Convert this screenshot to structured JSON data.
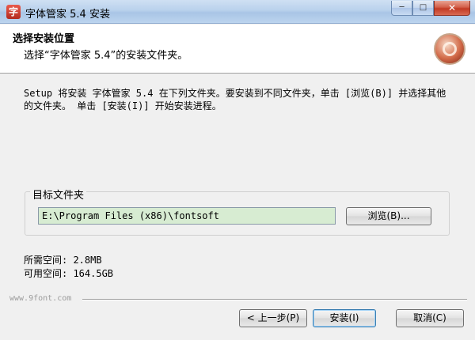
{
  "window": {
    "title": "字体管家 5.4 安装",
    "app_icon": "font-manager-icon",
    "minimize_glyph": "─",
    "maximize_glyph": "□",
    "close_glyph": "✕"
  },
  "header": {
    "title": "选择安装位置",
    "subtitle": "选择“字体管家 5.4”的安装文件夹。",
    "logo_icon": "installer-logo-icon"
  },
  "body": {
    "description": "Setup 将安装 字体管家 5.4 在下列文件夹。要安装到不同文件夹，单击 [浏览(B)] 并选择其他的文件夹。 单击 [安装(I)] 开始安装进程。",
    "destination": {
      "group_label": "目标文件夹",
      "path_value": "E:\\Program Files (x86)\\fontsoft",
      "browse_label": "浏览(B)..."
    },
    "space_required": "所需空间: 2.8MB",
    "space_available": "可用空间: 164.5GB"
  },
  "footer": {
    "watermark": "www.9font.com",
    "back_label": "< 上一步(P)",
    "install_label": "安装(I)",
    "cancel_label": "取消(C)"
  },
  "colors": {
    "path_input_bg": "#d7ecd2",
    "titlebar": "#b9d1ec",
    "close_button": "#c23a25"
  }
}
